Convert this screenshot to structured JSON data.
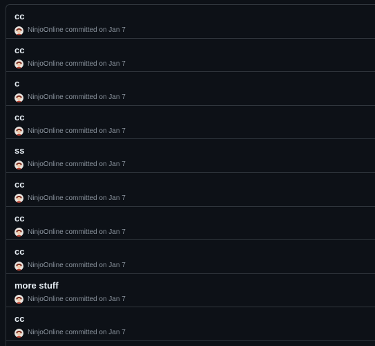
{
  "commits": [
    {
      "title": "cc",
      "author": "NinjoOnline",
      "action": "committed",
      "date_text": "on Jan 7"
    },
    {
      "title": "cc",
      "author": "NinjoOnline",
      "action": "committed",
      "date_text": "on Jan 7"
    },
    {
      "title": "c",
      "author": "NinjoOnline",
      "action": "committed",
      "date_text": "on Jan 7"
    },
    {
      "title": "cc",
      "author": "NinjoOnline",
      "action": "committed",
      "date_text": "on Jan 7"
    },
    {
      "title": "ss",
      "author": "NinjoOnline",
      "action": "committed",
      "date_text": "on Jan 7"
    },
    {
      "title": "cc",
      "author": "NinjoOnline",
      "action": "committed",
      "date_text": "on Jan 7"
    },
    {
      "title": "cc",
      "author": "NinjoOnline",
      "action": "committed",
      "date_text": "on Jan 7"
    },
    {
      "title": "cc",
      "author": "NinjoOnline",
      "action": "committed",
      "date_text": "on Jan 7"
    },
    {
      "title": "more stuff",
      "author": "NinjoOnline",
      "action": "committed",
      "date_text": "on Jan 7"
    },
    {
      "title": "cc",
      "author": "NinjoOnline",
      "action": "committed",
      "date_text": "on Jan 7"
    }
  ],
  "colors": {
    "background": "#0d1117",
    "border": "#30363d",
    "title": "#e6edf3",
    "meta": "#8d96a0"
  },
  "icons": {
    "avatar": "user-avatar-icon"
  }
}
